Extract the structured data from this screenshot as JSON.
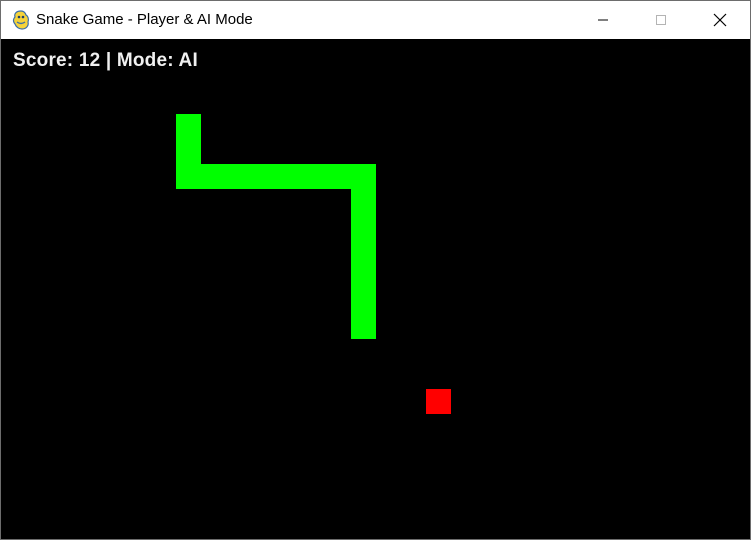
{
  "window": {
    "title": "Snake Game - Player & AI Mode",
    "app_icon": "pygame-snake-icon",
    "buttons": {
      "minimize": "minimize-icon",
      "maximize": "maximize-icon",
      "close": "close-icon"
    }
  },
  "hud": {
    "text": "Score: 12 | Mode: AI",
    "score": 12,
    "mode": "AI"
  },
  "game": {
    "snake_color": "#00ff00",
    "food_color": "#ff0000",
    "background_color": "#000000",
    "snake_cells": [
      [
        7,
        3
      ],
      [
        7,
        4
      ],
      [
        7,
        5
      ],
      [
        8,
        5
      ],
      [
        9,
        5
      ],
      [
        10,
        5
      ],
      [
        11,
        5
      ],
      [
        12,
        5
      ],
      [
        13,
        5
      ],
      [
        14,
        5
      ],
      [
        14,
        6
      ],
      [
        14,
        7
      ],
      [
        14,
        8
      ],
      [
        14,
        9
      ],
      [
        14,
        10
      ],
      [
        14,
        11
      ]
    ],
    "food_cell": [
      17,
      14
    ]
  }
}
